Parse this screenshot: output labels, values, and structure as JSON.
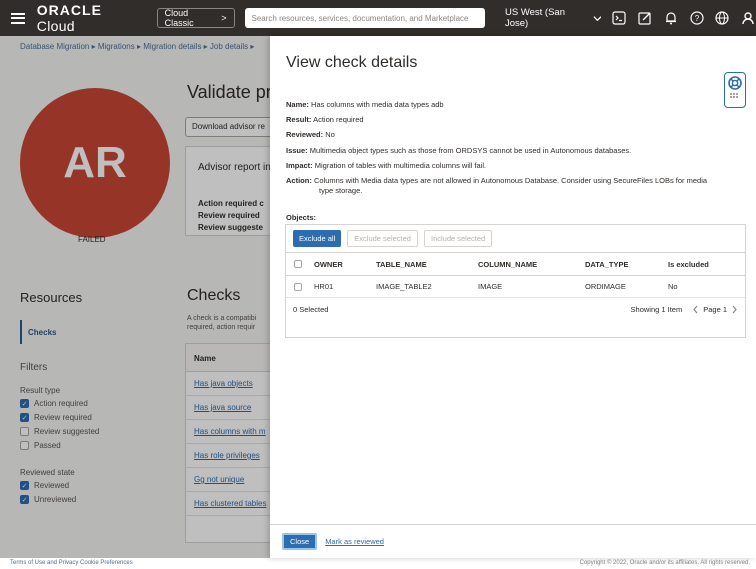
{
  "topbar": {
    "brand_bold": "ORACLE",
    "brand_rest": "Cloud",
    "classic_label": "Cloud Classic",
    "classic_chevron": ">",
    "search_placeholder": "Search resources, services, documentation, and Marketplace",
    "region": "US West (San Jose)",
    "icons": [
      "cloud-shell-icon",
      "edit-icon",
      "notifications-icon",
      "help-icon",
      "language-icon",
      "profile-icon"
    ]
  },
  "background": {
    "breadcrumb": "Database Migration ▸ Migrations ▸ Migration details ▸ Job details ▸",
    "avatar_initials": "AR",
    "status": "FAILED",
    "page_title": "Validate pr",
    "download_button": "Download advisor re",
    "advisor_title": "Advisor report in",
    "advisor_lines": [
      "Action required c",
      "Review required",
      "Review suggeste"
    ],
    "resources_title": "Resources",
    "resources_checks": "Checks",
    "filters_title": "Filters",
    "result_type_label": "Result type",
    "result_types": [
      {
        "label": "Action required",
        "checked": true
      },
      {
        "label": "Review required",
        "checked": true
      },
      {
        "label": "Review suggested",
        "checked": false
      },
      {
        "label": "Passed",
        "checked": false
      }
    ],
    "reviewed_state_label": "Reviewed state",
    "reviewed_states": [
      {
        "label": "Reviewed",
        "checked": true
      },
      {
        "label": "Unreviewed",
        "checked": true
      }
    ],
    "checks_title": "Checks",
    "checks_desc": "A check is a compatibi required, action requir",
    "checks_col": "Name",
    "checks_rows": [
      "Has java objects",
      "Has java source",
      "Has columns with m",
      "Has role privileges",
      "Gg not unique",
      "Has clustered tables"
    ],
    "footer_left": "Terms of Use and Privacy    Cookie Preferences",
    "footer_right": "Copyright © 2022, Oracle and/or its affiliates. All rights reserved."
  },
  "panel": {
    "title": "View check details",
    "name_label": "Name:",
    "name_value": "Has columns with media data types adb",
    "result_label": "Result:",
    "result_value": "Action required",
    "reviewed_label": "Reviewed:",
    "reviewed_value": "No",
    "issue_label": "Issue:",
    "issue_value": "Multimedia object types such as those from ORDSYS cannot be used in Autonomous databases.",
    "impact_label": "Impact:",
    "impact_value": "Migration of tables with multimedia columns will fail.",
    "action_label": "Action:",
    "action_value_1": "Columns with Media data types are not allowed in Autonomous Database. Consider using SecureFiles LOBs for media",
    "action_value_2": "type storage.",
    "objects_label": "Objects:",
    "buttons": {
      "exclude_all": "Exclude all",
      "exclude_selected": "Exclude selected",
      "include_selected": "Include selected"
    },
    "columns": [
      "OWNER",
      "TABLE_NAME",
      "COLUMN_NAME",
      "DATA_TYPE",
      "Is excluded"
    ],
    "rows": [
      {
        "owner": "HR01",
        "table_name": "IMAGE_TABLE2",
        "column_name": "IMAGE",
        "data_type": "ORDIMAGE",
        "is_excluded": "No"
      }
    ],
    "selected_count": "0 Selected",
    "showing": "Showing 1 Item",
    "page": "Page 1",
    "close_button": "Close",
    "mark_reviewed": "Mark as reviewed"
  },
  "colors": {
    "topbar": "#312d2a",
    "accent": "#2c6cb0",
    "avatar": "#c74634"
  }
}
